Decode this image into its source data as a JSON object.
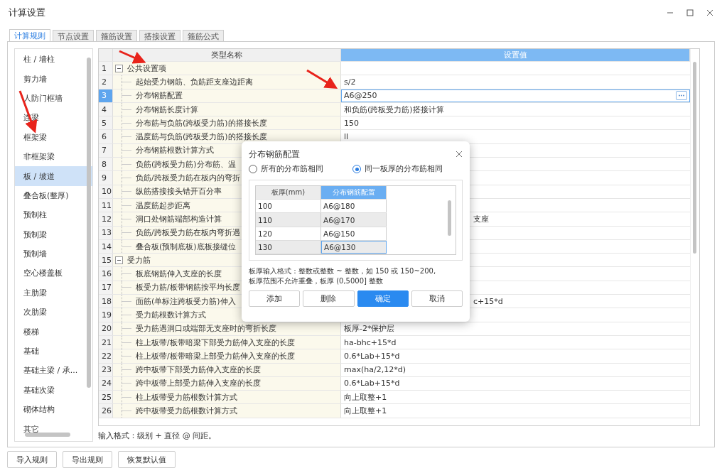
{
  "window": {
    "title": "计算设置"
  },
  "tabs": [
    {
      "label": "计算规则",
      "selected": true
    },
    {
      "label": "节点设置",
      "selected": false
    },
    {
      "label": "箍筋设置",
      "selected": false
    },
    {
      "label": "搭接设置",
      "selected": false
    },
    {
      "label": "箍筋公式",
      "selected": false
    }
  ],
  "sidebar": {
    "items": [
      {
        "label": "柱 / 墙柱",
        "selected": false
      },
      {
        "label": "剪力墙",
        "selected": false
      },
      {
        "label": "人防门框墙",
        "selected": false
      },
      {
        "label": "连梁",
        "selected": false
      },
      {
        "label": "框架梁",
        "selected": false
      },
      {
        "label": "非框架梁",
        "selected": false
      },
      {
        "label": "板 / 坡道",
        "selected": true
      },
      {
        "label": "叠合板(整厚)",
        "selected": false
      },
      {
        "label": "预制柱",
        "selected": false
      },
      {
        "label": "预制梁",
        "selected": false
      },
      {
        "label": "预制墙",
        "selected": false
      },
      {
        "label": "空心楼盖板",
        "selected": false
      },
      {
        "label": "主肋梁",
        "selected": false
      },
      {
        "label": "次肋梁",
        "selected": false
      },
      {
        "label": "楼梯",
        "selected": false
      },
      {
        "label": "基础",
        "selected": false
      },
      {
        "label": "基础主梁 / 承...",
        "selected": false
      },
      {
        "label": "基础次梁",
        "selected": false
      },
      {
        "label": "砌体结构",
        "selected": false
      },
      {
        "label": "其它",
        "selected": false
      }
    ]
  },
  "table": {
    "columns": [
      "类型名称",
      "设置值"
    ],
    "rows": [
      {
        "num": "1",
        "name": "公共设置项",
        "expanded": true,
        "selected": false,
        "children": [
          {
            "num": "2",
            "name": "起始受力钢筋、负筋距支座边距离",
            "value": "s/2",
            "selected": false
          },
          {
            "num": "3",
            "name": "分布钢筋配置",
            "value": "A6@250",
            "selected": true
          },
          {
            "num": "4",
            "name": "分布钢筋长度计算",
            "value": "和负筋(跨板受力筋)搭接计算",
            "selected": false
          },
          {
            "num": "5",
            "name": "分布筋与负筋(跨板受力筋)的搭接长度",
            "value": "150",
            "selected": false
          },
          {
            "num": "6",
            "name": "温度筋与负筋(跨板受力筋)的搭接长度",
            "value": "ll",
            "selected": false
          },
          {
            "num": "7",
            "name": "分布钢筋根数计算方式",
            "selected": false
          },
          {
            "num": "8",
            "name": "负筋(跨板受力筋)分布筋、温",
            "selected": false
          },
          {
            "num": "9",
            "name": "负筋/跨板受力筋在板内的弯折",
            "selected": false
          },
          {
            "num": "10",
            "name": "纵筋搭接接头错开百分率",
            "selected": false
          },
          {
            "num": "11",
            "name": "温度筋起步距离",
            "selected": false
          },
          {
            "num": "12",
            "name": "洞口处钢筋端部构造计算",
            "value": "支座",
            "value_cut": true,
            "selected": false
          },
          {
            "num": "13",
            "name": "负筋/跨板受力筋在板内弯折遇",
            "selected": false
          },
          {
            "num": "14",
            "name": "叠合板(预制底板)底板接缝位",
            "selected": false
          }
        ]
      },
      {
        "num": "15",
        "name": "受力筋",
        "expanded": true,
        "selected": false,
        "children": [
          {
            "num": "16",
            "name": "板底钢筋伸入支座的长度",
            "selected": false
          },
          {
            "num": "17",
            "name": "板受力筋/板带钢筋按平均长度",
            "selected": false
          },
          {
            "num": "18",
            "name": "面筋(单标注跨板受力筋)伸入",
            "value": "c+15*d",
            "value_cut": true,
            "selected": false
          },
          {
            "num": "19",
            "name": "受力筋根数计算方式",
            "selected": false
          },
          {
            "num": "20",
            "name": "受力筋遇洞口或端部无支座时的弯折长度",
            "value": "板厚-2*保护层",
            "selected": false
          },
          {
            "num": "21",
            "name": "柱上板带/板带暗梁下部受力筋伸入支座的长度",
            "value": "ha-bhc+15*d",
            "selected": false
          },
          {
            "num": "22",
            "name": "柱上板带/板带暗梁上部受力筋伸入支座的长度",
            "value": "0.6*Lab+15*d",
            "selected": false
          },
          {
            "num": "23",
            "name": "跨中板带下部受力筋伸入支座的长度",
            "value": "max(ha/2,12*d)",
            "selected": false
          },
          {
            "num": "24",
            "name": "跨中板带上部受力筋伸入支座的长度",
            "value": "0.6*Lab+15*d",
            "selected": false
          },
          {
            "num": "25",
            "name": "柱上板带受力筋根数计算方式",
            "value": "向上取整+1",
            "selected": false
          },
          {
            "num": "26",
            "name": "跨中板带受力筋根数计算方式",
            "value": "向上取整+1",
            "selected": false
          }
        ]
      }
    ]
  },
  "input_hint": "输入格式：级别 + 直径 @ 间距。",
  "buttons": [
    "导入规则",
    "导出规则",
    "恢复默认值"
  ],
  "dialog": {
    "title": "分布钢筋配置",
    "options": [
      {
        "label": "所有的分布筋相同",
        "selected": false
      },
      {
        "label": "同一板厚的分布筋相同",
        "selected": true
      }
    ],
    "columns": [
      "板厚(mm)",
      "分布钢筋配置"
    ],
    "rows": [
      {
        "thickness": "100",
        "config": "A6@180",
        "selected": false
      },
      {
        "thickness": "110",
        "config": "A6@170",
        "selected": false
      },
      {
        "thickness": "120",
        "config": "A6@150",
        "selected": false
      },
      {
        "thickness": "130",
        "config": "A6@130",
        "selected": true
      }
    ],
    "notes": [
      "板厚输入格式：整数或整数 ~ 整数，如 150 或 150~200,",
      "板厚范围不允许重叠，板厚 (0,5000] 整数"
    ],
    "buttons": [
      {
        "label": "添加",
        "primary": false
      },
      {
        "label": "删除",
        "primary": false
      },
      {
        "label": "确定",
        "primary": true
      },
      {
        "label": "取消",
        "primary": false
      }
    ]
  }
}
